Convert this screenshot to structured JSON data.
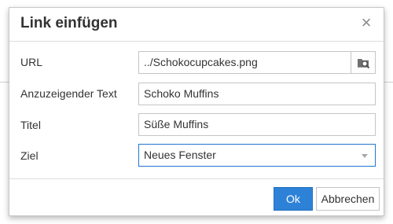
{
  "dialog": {
    "title": "Link einfügen",
    "close_symbol": "×"
  },
  "form": {
    "url": {
      "label": "URL",
      "value": "../Schokocupcakes.png",
      "browse_icon": "browse-icon"
    },
    "text": {
      "label": "Anzuzeigender Text",
      "value": "Schoko Muffins"
    },
    "title": {
      "label": "Titel",
      "value": "Süße Muffins"
    },
    "target": {
      "label": "Ziel",
      "value": "Neues Fenster"
    }
  },
  "buttons": {
    "ok": "Ok",
    "cancel": "Abbrechen"
  },
  "colors": {
    "primary": "#2d82d8",
    "focus_border": "#2276d2"
  }
}
